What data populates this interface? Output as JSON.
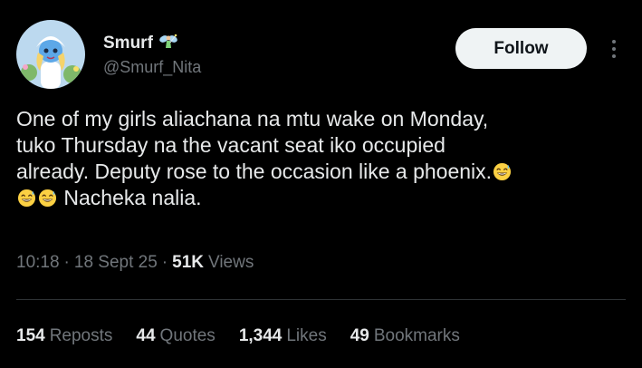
{
  "author": {
    "display_name": "Smurf",
    "badge_icon": "fairy-icon",
    "username": "@Smurf_Nita",
    "avatar": "avatar-smurfette"
  },
  "follow_label": "Follow",
  "tweet": {
    "lines": [
      "One of my girls aliachana na mtu wake on Monday,",
      "tuko Thursday na the vacant seat iko occupied",
      "already. Deputy rose to the occasion like a phoenix.",
      "Nacheka nalia."
    ],
    "emoji": "grinning-sweat-emoji"
  },
  "meta": {
    "time": "10:18",
    "date": "18 Sept 25",
    "views_count": "51K",
    "views_label": "Views"
  },
  "stats": {
    "reposts_count": "154",
    "reposts_label": "Reposts",
    "quotes_count": "44",
    "quotes_label": "Quotes",
    "likes_count": "1,344",
    "likes_label": "Likes",
    "bookmarks_count": "49",
    "bookmarks_label": "Bookmarks"
  },
  "colors": {
    "background": "#000000",
    "text_primary": "#e7e9ea",
    "text_secondary": "#71767b",
    "button_bg": "#eff3f4",
    "divider": "#2f3336"
  }
}
